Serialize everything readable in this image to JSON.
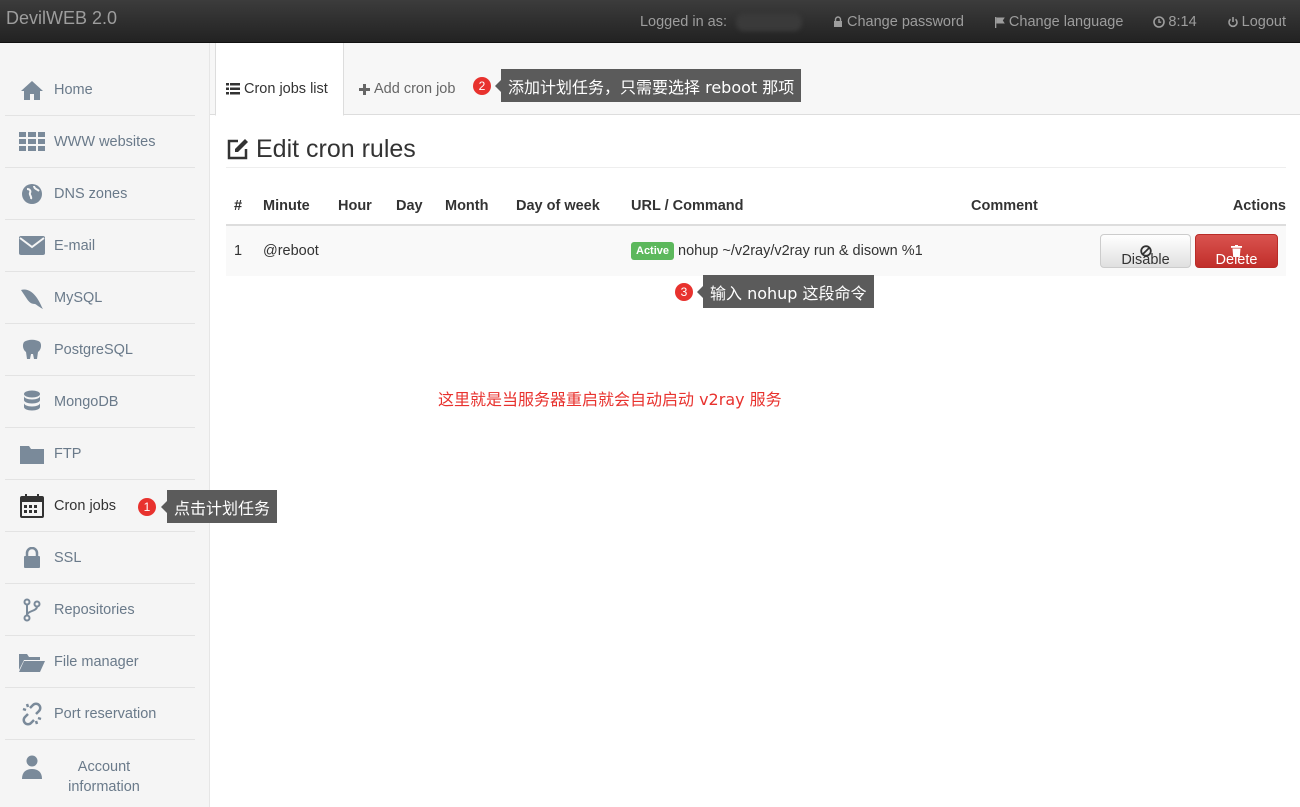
{
  "navbar": {
    "brand": "DevilWEB 2.0",
    "logged_in_label": "Logged in as:",
    "change_password": "Change password",
    "change_language": "Change language",
    "session_time": "8:14",
    "logout": "Logout"
  },
  "sidebar": {
    "items": [
      {
        "label": "Home",
        "icon": "home-icon"
      },
      {
        "label": "WWW websites",
        "icon": "grid-icon"
      },
      {
        "label": "DNS zones",
        "icon": "globe-icon"
      },
      {
        "label": "E-mail",
        "icon": "envelope-icon"
      },
      {
        "label": "MySQL",
        "icon": "dolphin-icon"
      },
      {
        "label": "PostgreSQL",
        "icon": "elephant-icon"
      },
      {
        "label": "MongoDB",
        "icon": "database-icon"
      },
      {
        "label": "FTP",
        "icon": "folder-icon"
      },
      {
        "label": "Cron jobs",
        "icon": "calendar-icon"
      },
      {
        "label": "SSL",
        "icon": "lock-icon"
      },
      {
        "label": "Repositories",
        "icon": "branch-icon"
      },
      {
        "label": "File manager",
        "icon": "folder-open-icon"
      },
      {
        "label": "Port reservation",
        "icon": "unlink-icon"
      },
      {
        "label": "Account information",
        "icon": "user-icon"
      }
    ]
  },
  "tabs": {
    "list": "Cron jobs list",
    "add": "Add cron job"
  },
  "heading": "Edit cron rules",
  "table": {
    "headers": {
      "num": "#",
      "minute": "Minute",
      "hour": "Hour",
      "day": "Day",
      "month": "Month",
      "dow": "Day of week",
      "command": "URL / Command",
      "comment": "Comment",
      "actions": "Actions"
    },
    "rows": [
      {
        "num": "1",
        "minute": "@reboot",
        "status": "Active",
        "command": "nohup ~/v2ray/v2ray run & disown %1",
        "disable": "Disable",
        "delete": "Delete"
      }
    ]
  },
  "annotations": {
    "a1": {
      "num": "1",
      "text": "点击计划任务"
    },
    "a2": {
      "num": "2",
      "text": "添加计划任务，只需要选择 reboot 那项"
    },
    "a3": {
      "num": "3",
      "text": "输入 nohup 这段命令"
    },
    "note": "这里就是当服务器重启就会自动启动 v2ray 服务"
  },
  "colors": {
    "navbar": "#222222",
    "active_badge": "#5cb85c",
    "delete_button": "#d9534f",
    "annotation": "#e8322e",
    "sidebar_icon": "#7a8a9a"
  }
}
